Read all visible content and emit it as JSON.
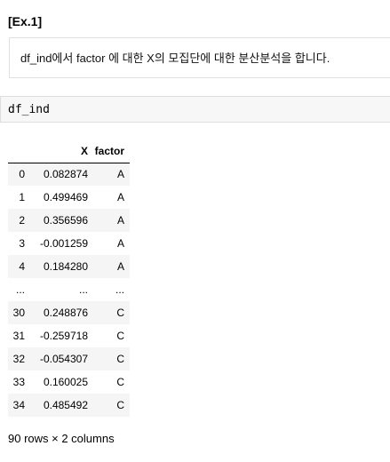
{
  "cell_heading": "[Ex.1]",
  "markdown": {
    "text": "df_ind에서 factor 에 대한 X의 모집단에 대한 분산분석을 합니다."
  },
  "code": {
    "input": "df_ind"
  },
  "dataframe": {
    "columns": [
      "",
      "X",
      "factor"
    ],
    "rows": [
      {
        "index": "0",
        "X": "0.082874",
        "factor": "A"
      },
      {
        "index": "1",
        "X": "0.499469",
        "factor": "A"
      },
      {
        "index": "2",
        "X": "0.356596",
        "factor": "A"
      },
      {
        "index": "3",
        "X": "-0.001259",
        "factor": "A"
      },
      {
        "index": "4",
        "X": "0.184280",
        "factor": "A"
      },
      {
        "index": "...",
        "X": "...",
        "factor": "..."
      },
      {
        "index": "30",
        "X": "0.248876",
        "factor": "C"
      },
      {
        "index": "31",
        "X": "-0.259718",
        "factor": "C"
      },
      {
        "index": "32",
        "X": "-0.054307",
        "factor": "C"
      },
      {
        "index": "33",
        "X": "0.160025",
        "factor": "C"
      },
      {
        "index": "34",
        "X": "0.485492",
        "factor": "C"
      }
    ],
    "shape_text": "90 rows × 2 columns"
  }
}
